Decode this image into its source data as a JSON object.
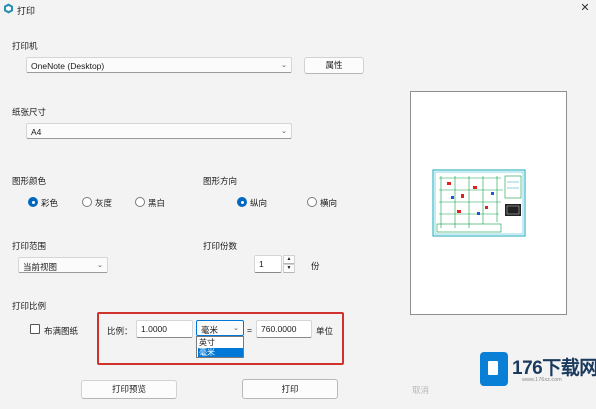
{
  "window": {
    "title": "打印",
    "close_glyph": "✕"
  },
  "printer": {
    "label": "打印机",
    "selected": "OneNote (Desktop)",
    "properties_label": "属性"
  },
  "paper_size": {
    "label": "纸张尺寸",
    "selected": "A4"
  },
  "graphic_color": {
    "label": "图形颜色",
    "options": [
      "彩色",
      "灰度",
      "黑白"
    ],
    "selected": "彩色"
  },
  "orientation": {
    "label": "图形方向",
    "options": [
      "纵向",
      "横向"
    ],
    "selected": "纵向"
  },
  "print_range": {
    "label": "打印范围",
    "selected": "当前视图"
  },
  "copies": {
    "label": "打印份数",
    "value": "1",
    "unit": "份"
  },
  "scale": {
    "label": "打印比例",
    "fit_paper_label": "布满图纸",
    "fit_paper_checked": false,
    "ratio_label": "比例：",
    "ratio_value": "1.0000",
    "unit_selected": "毫米",
    "unit_options": [
      "英寸",
      "毫米"
    ],
    "highlighted_option": "毫米",
    "equals": "=",
    "drawing_value": "760.0000",
    "drawing_unit_label": "单位"
  },
  "buttons": {
    "preview": "打印预览",
    "print": "打印",
    "cancel": "取消"
  },
  "watermark": {
    "brand": "176下载网",
    "url": "www.176xz.com"
  },
  "colors": {
    "accent": "#0067c0",
    "highlight_box": "#d0312d",
    "option_highlight": "#0078d7"
  },
  "icons": {
    "app": "app-logo-icon",
    "close": "close-icon",
    "chevron": "chevron-down-icon",
    "spin_up": "spin-up-icon",
    "spin_down": "spin-down-icon"
  }
}
